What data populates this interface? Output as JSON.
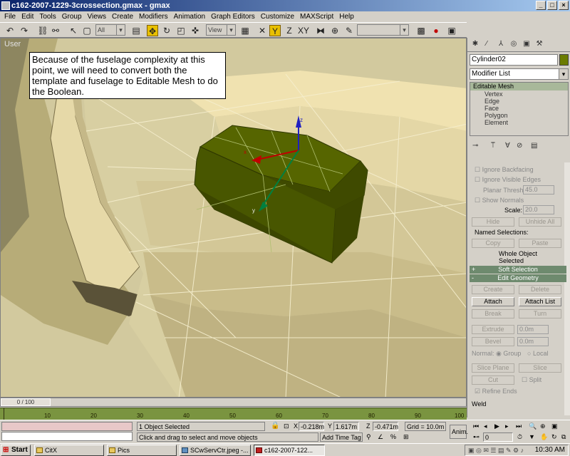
{
  "window": {
    "title": "c162-2007-1229-3crossection.gmax - gmax"
  },
  "menu": [
    "File",
    "Edit",
    "Tools",
    "Group",
    "Views",
    "Create",
    "Modifiers",
    "Animation",
    "Graph Editors",
    "Customize",
    "MAXScript",
    "Help"
  ],
  "toolbar": {
    "selection_filter": "All",
    "ref_coord": "View",
    "named_selection": ""
  },
  "viewport": {
    "label": "User",
    "caption": "Because of the fuselage complexity at this point, we will need to convert both the template and fuselage to Editable Mesh to do the Boolean.",
    "gizmo_z": "z",
    "gizmo_x": "x",
    "gizmo_y": "y"
  },
  "command_panel": {
    "object_name": "Cylinder02",
    "object_color": "#6b7c00",
    "modifier_list": "Modifier List",
    "stack_top": "Editable Mesh",
    "stack_items": [
      "Vertex",
      "Edge",
      "Face",
      "Polygon",
      "Element"
    ],
    "selection": {
      "ignore_backfacing": "Ignore Backfacing",
      "ignore_visible_edges": "Ignore Visible Edges",
      "planar_thresh_label": "Planar Thresh:",
      "planar_thresh_value": "45.0",
      "show_normals": "Show Normals",
      "scale_label": "Scale:",
      "scale_value": "20.0",
      "hide": "Hide",
      "unhide_all": "Unhide All",
      "named_selections": "Named Selections:",
      "copy": "Copy",
      "paste": "Paste",
      "whole_object": "Whole Object Selected"
    },
    "soft_selection": {
      "sign": "+",
      "label": "Soft Selection"
    },
    "edit_geometry": {
      "sign": "-",
      "label": "Edit Geometry",
      "create": "Create",
      "delete": "Delete",
      "attach": "Attach",
      "attach_list": "Attach List",
      "break": "Break",
      "turn": "Turn",
      "extrude": "Extrude",
      "extrude_value": "0.0m",
      "bevel": "Bevel",
      "bevel_value": "0.0m",
      "normal_label": "Normal:",
      "group": "Group",
      "local": "Local",
      "slice_plane": "Slice Plane",
      "slice": "Slice",
      "cut": "Cut",
      "split": "Split",
      "refine_ends": "Refine Ends",
      "weld": "Weld"
    }
  },
  "timeline": {
    "slider": "0 / 100",
    "ticks": [
      "10",
      "20",
      "30",
      "40",
      "50",
      "60",
      "70",
      "80",
      "90",
      "100"
    ]
  },
  "status": {
    "selected": "1 Object Selected",
    "prompt": "Click and drag to select and move objects",
    "x_label": "X",
    "x_value": "-0.218m",
    "y_label": "Y",
    "y_value": "1.617m",
    "z_label": "Z",
    "z_value": "-0.471m",
    "grid": "Grid = 10.0m",
    "add_time_tag": "Add Time Tag",
    "anim": "Anim.",
    "frame": "0"
  },
  "taskbar": {
    "start": "Start",
    "items": [
      "CitX",
      "Pics",
      "SCwServCtr.jpeg -...",
      "c162-2007-122..."
    ],
    "clock": "10:30 AM"
  }
}
